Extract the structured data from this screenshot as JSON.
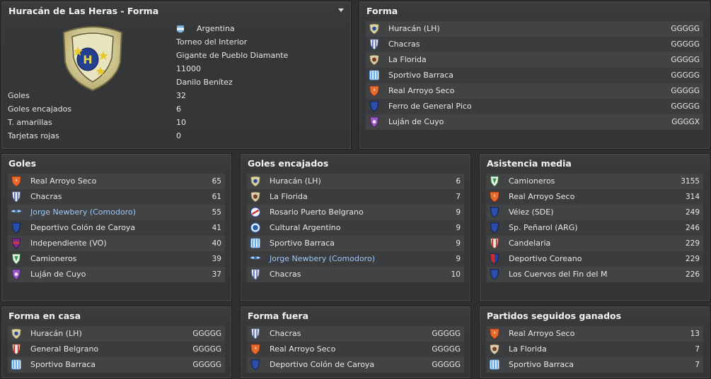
{
  "profile": {
    "title": "Huracán de Las Heras - Forma",
    "country": "Argentina",
    "league": "Torneo del Interior",
    "stadium": "Gigante de Pueblo Diamante",
    "capacity": "11000",
    "manager": "Danilo Benítez",
    "stats": [
      {
        "label": "Goles",
        "value": "32"
      },
      {
        "label": "Goles encajados",
        "value": "6"
      },
      {
        "label": "T. amarillas",
        "value": "10"
      },
      {
        "label": "Tarjetas rojas",
        "value": "0"
      }
    ]
  },
  "forma": {
    "title": "Forma",
    "rows": [
      {
        "name": "Huracán (LH)",
        "value": "GGGGG",
        "crest": "shield-beige",
        "link": false
      },
      {
        "name": "Chacras",
        "value": "GGGGG",
        "crest": "shield-stripes-white",
        "link": false
      },
      {
        "name": "La Florida",
        "value": "GGGGG",
        "crest": "shield-beige-round",
        "link": false
      },
      {
        "name": "Sportivo Barraca",
        "value": "GGGGG",
        "crest": "shield-stripes-blue",
        "link": false
      },
      {
        "name": "Real Arroyo Seco",
        "value": "GGGGG",
        "crest": "shield-orange",
        "link": false
      },
      {
        "name": "Ferro de General Pico",
        "value": "GGGGG",
        "crest": "shield-blue",
        "link": false
      },
      {
        "name": "Luján de Cuyo",
        "value": "GGGGX",
        "crest": "shield-purple",
        "link": false
      }
    ]
  },
  "goles": {
    "title": "Goles",
    "rows": [
      {
        "name": "Real Arroyo Seco",
        "value": "65",
        "crest": "shield-orange",
        "link": false
      },
      {
        "name": "Chacras",
        "value": "61",
        "crest": "shield-stripes-white",
        "link": false
      },
      {
        "name": "Jorge Newbery (Comodoro)",
        "value": "55",
        "crest": "wings-blue",
        "link": true
      },
      {
        "name": "Deportivo Colón de Caroya",
        "value": "41",
        "crest": "shield-blue",
        "link": false
      },
      {
        "name": "Independiente (VO)",
        "value": "40",
        "crest": "shield-purple-red",
        "link": false
      },
      {
        "name": "Camioneros",
        "value": "39",
        "crest": "shield-green",
        "link": false
      },
      {
        "name": "Luján de Cuyo",
        "value": "37",
        "crest": "shield-purple",
        "link": false
      }
    ]
  },
  "encajados": {
    "title": "Goles encajados",
    "rows": [
      {
        "name": "Huracán (LH)",
        "value": "6",
        "crest": "shield-beige",
        "link": false
      },
      {
        "name": "La Florida",
        "value": "7",
        "crest": "shield-beige-round",
        "link": false
      },
      {
        "name": "Rosario Puerto Belgrano",
        "value": "9",
        "crest": "round-blue-red",
        "link": false
      },
      {
        "name": "Cultural Argentino",
        "value": "9",
        "crest": "round-blue",
        "link": false
      },
      {
        "name": "Sportivo Barraca",
        "value": "9",
        "crest": "shield-stripes-blue",
        "link": false
      },
      {
        "name": "Jorge Newbery (Comodoro)",
        "value": "9",
        "crest": "wings-blue",
        "link": true
      },
      {
        "name": "Chacras",
        "value": "10",
        "crest": "shield-stripes-white",
        "link": false
      }
    ]
  },
  "asistencia": {
    "title": "Asistencia media",
    "rows": [
      {
        "name": "Camioneros",
        "value": "3155",
        "crest": "shield-green",
        "link": false
      },
      {
        "name": "Real Arroyo Seco",
        "value": "314",
        "crest": "shield-orange",
        "link": false
      },
      {
        "name": "Vélez (SDE)",
        "value": "249",
        "crest": "shield-blue",
        "link": false
      },
      {
        "name": "Sp. Peñarol (ARG)",
        "value": "246",
        "crest": "shield-blue",
        "link": false
      },
      {
        "name": "Candelaria",
        "value": "229",
        "crest": "shield-stripes-red",
        "link": false
      },
      {
        "name": "Deportivo Coreano",
        "value": "229",
        "crest": "shield-blue-red",
        "link": false
      },
      {
        "name": "Los Cuervos del Fin del M",
        "value": "226",
        "crest": "shield-blue",
        "link": false
      }
    ]
  },
  "casa": {
    "title": "Forma en casa",
    "rows": [
      {
        "name": "Huracán (LH)",
        "value": "GGGGG",
        "crest": "shield-beige",
        "link": false
      },
      {
        "name": "General Belgrano",
        "value": "GGGGG",
        "crest": "shield-stripes-red",
        "link": false
      },
      {
        "name": "Sportivo Barraca",
        "value": "GGGGG",
        "crest": "shield-stripes-blue",
        "link": false
      }
    ]
  },
  "fuera": {
    "title": "Forma fuera",
    "rows": [
      {
        "name": "Chacras",
        "value": "GGGGG",
        "crest": "shield-stripes-white",
        "link": false
      },
      {
        "name": "Real Arroyo Seco",
        "value": "GGGGG",
        "crest": "shield-orange",
        "link": false
      },
      {
        "name": "Deportivo Colón de Caroya",
        "value": "GGGGG",
        "crest": "shield-blue",
        "link": false
      }
    ]
  },
  "ganados": {
    "title": "Partidos seguidos ganados",
    "rows": [
      {
        "name": "Real Arroyo Seco",
        "value": "13",
        "crest": "shield-orange",
        "link": false
      },
      {
        "name": "La Florida",
        "value": "7",
        "crest": "shield-beige-round",
        "link": false
      },
      {
        "name": "Sportivo Barraca",
        "value": "7",
        "crest": "shield-stripes-blue",
        "link": false
      }
    ]
  }
}
